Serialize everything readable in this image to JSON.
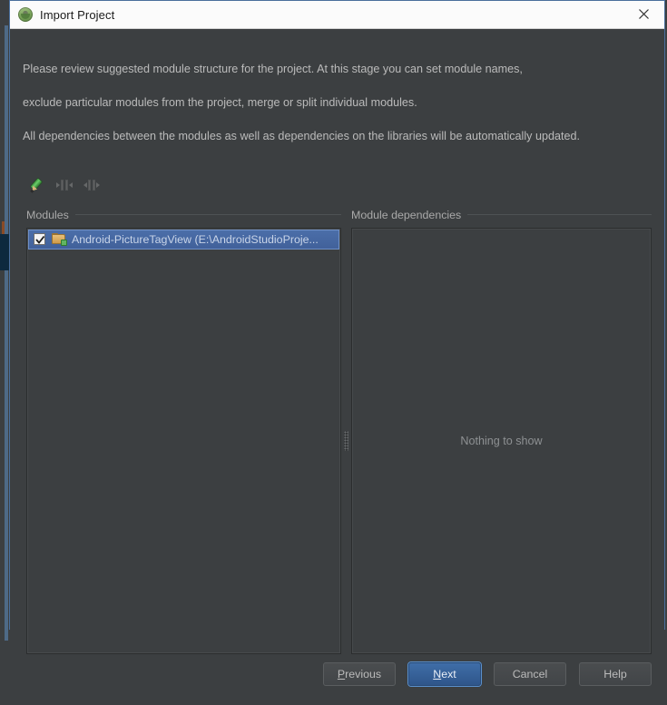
{
  "window": {
    "title": "Import Project",
    "app_icon": "android-studio-icon",
    "close_label": "close-icon"
  },
  "description": {
    "line1": "Please review suggested module structure for the project. At this stage you can set module names,",
    "line2": "exclude particular modules from the project, merge or split individual modules.",
    "line3": "All dependencies between the modules as well as dependencies on the libraries will be automatically updated."
  },
  "toolbar": {
    "items": [
      {
        "icon": "edit-pencil-icon",
        "enabled": true
      },
      {
        "icon": "merge-modules-icon",
        "enabled": false
      },
      {
        "icon": "split-module-icon",
        "enabled": false
      }
    ]
  },
  "panes": {
    "modules": {
      "label": "Modules",
      "rows": [
        {
          "checked": true,
          "icon": "module-folder-icon",
          "label": "Android-PictureTagView (E:\\AndroidStudioProje..."
        }
      ]
    },
    "dependencies": {
      "label": "Module dependencies",
      "empty_text": "Nothing to show"
    }
  },
  "buttons": {
    "previous": {
      "label": "Previous",
      "mnemonic": "P",
      "default": false
    },
    "next": {
      "label": "Next",
      "mnemonic": "N",
      "default": true
    },
    "cancel": {
      "label": "Cancel",
      "default": false
    },
    "help": {
      "label": "Help",
      "default": false
    }
  },
  "colors": {
    "dialog_bg": "#3c3f41",
    "dialog_border": "#4a6f9c",
    "titlebar_bg": "#fbfbfb",
    "text": "#bbbbbb",
    "selection_blue": "#41619a",
    "default_button_blue": "#3f6ea8"
  }
}
